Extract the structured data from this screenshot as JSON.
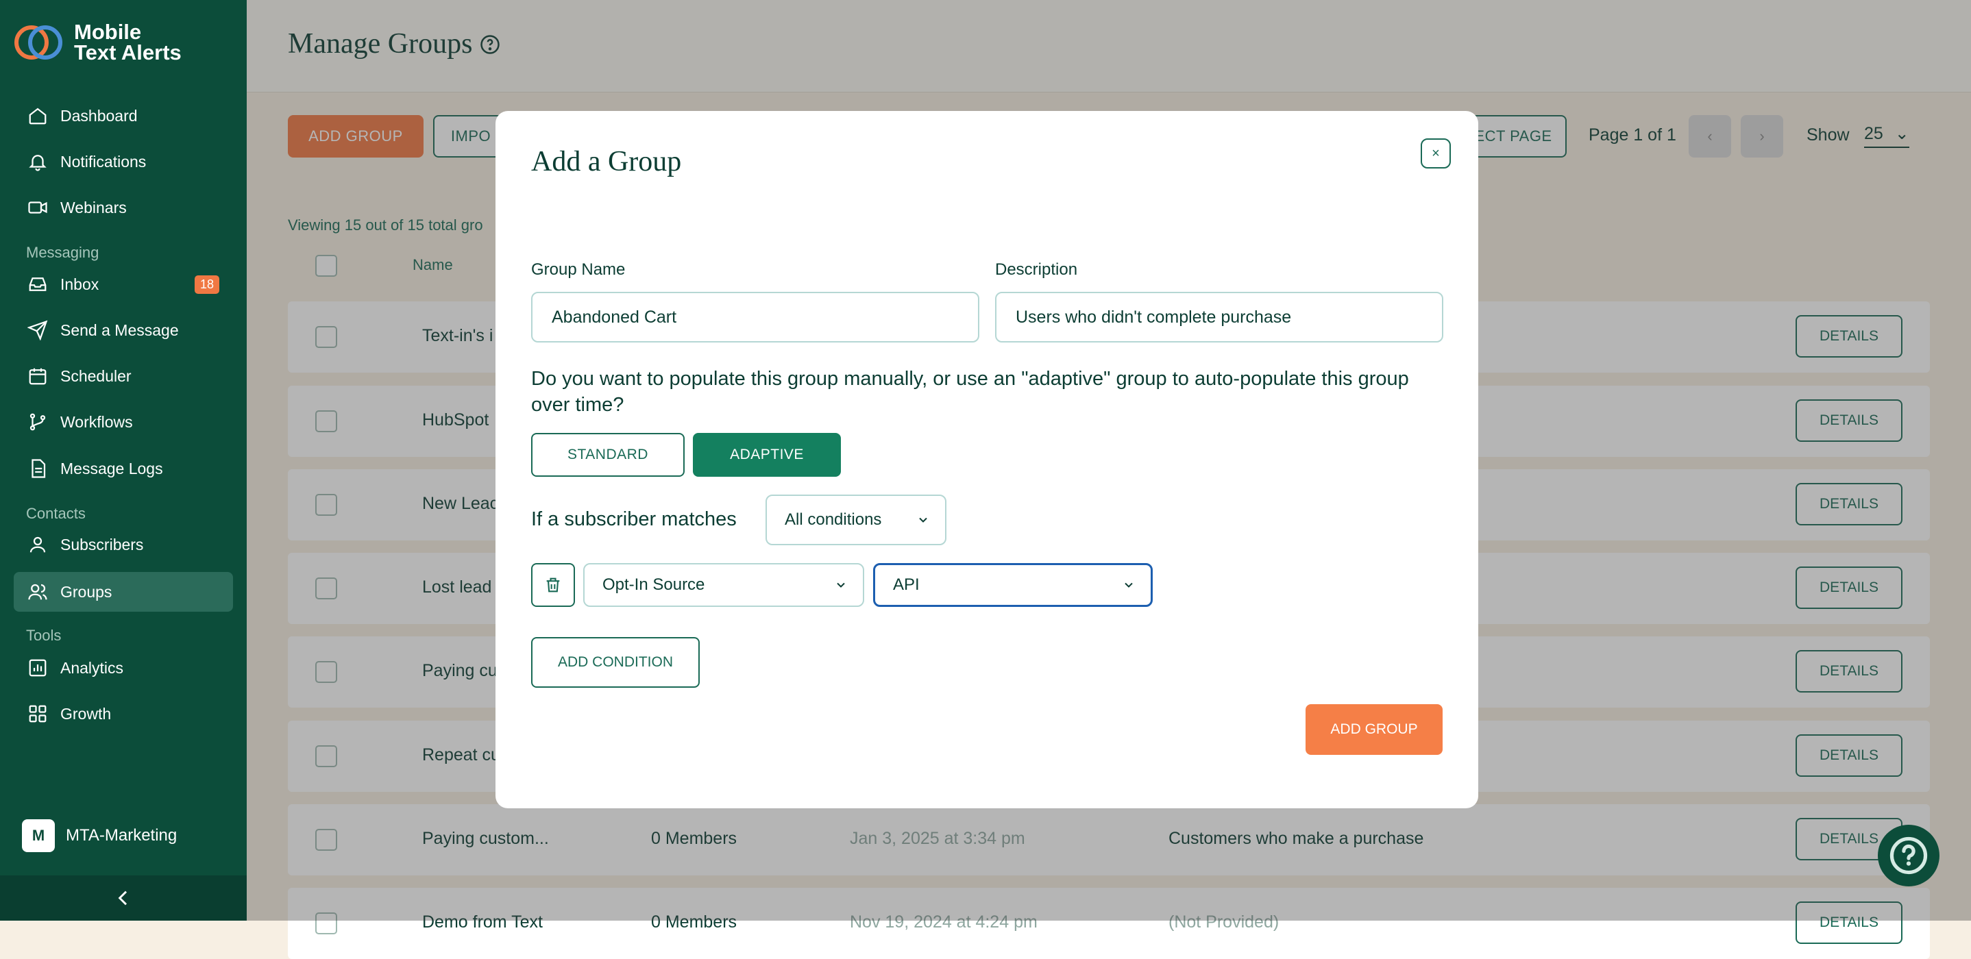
{
  "brand": {
    "line1": "Mobile",
    "line2": "Text Alerts"
  },
  "sidebar": {
    "items": [
      {
        "label": "Dashboard",
        "icon": "home-icon"
      },
      {
        "label": "Notifications",
        "icon": "bell-icon"
      },
      {
        "label": "Webinars",
        "icon": "video-icon"
      },
      {
        "label": "Inbox",
        "icon": "inbox-icon",
        "badge": "18"
      },
      {
        "label": "Send a Message",
        "icon": "send-icon"
      },
      {
        "label": "Scheduler",
        "icon": "calendar-icon"
      },
      {
        "label": "Workflows",
        "icon": "workflow-icon"
      },
      {
        "label": "Message Logs",
        "icon": "document-icon"
      },
      {
        "label": "Subscribers",
        "icon": "user-icon"
      },
      {
        "label": "Groups",
        "icon": "users-icon",
        "active": true
      },
      {
        "label": "Analytics",
        "icon": "chart-icon"
      },
      {
        "label": "Growth",
        "icon": "grid-icon"
      }
    ],
    "sections": {
      "messaging": "Messaging",
      "contacts": "Contacts",
      "tools": "Tools"
    },
    "account": {
      "initial": "M",
      "name": "MTA-Marketing"
    }
  },
  "header": {
    "title": "Manage Groups"
  },
  "toolbar": {
    "add_group": "ADD GROUP",
    "import": "IMPO",
    "select_page": "ECT PAGE",
    "page_info": "Page 1 of 1",
    "show_label": "Show",
    "show_value": "25"
  },
  "table": {
    "viewing": "Viewing 15 out of 15 total gro",
    "col_name": "Name",
    "details_label": "DETAILS",
    "rows": [
      {
        "name": "Text-in's i",
        "members": "",
        "date": "",
        "description": ""
      },
      {
        "name": "HubSpot",
        "members": "",
        "date": "",
        "description": ""
      },
      {
        "name": "New Leac",
        "members": "",
        "date": "",
        "description": ""
      },
      {
        "name": "Lost lead",
        "members": "",
        "date": "",
        "description": ""
      },
      {
        "name": "Paying cu",
        "members": "",
        "date": "",
        "description": ""
      },
      {
        "name": "Repeat cu",
        "members": "",
        "date": "",
        "description": ""
      },
      {
        "name": "Paying custom...",
        "members": "0 Members",
        "date": "Jan 3, 2025 at 3:34 pm",
        "description": "Customers who make a purchase"
      },
      {
        "name": "Demo from Text",
        "members": "0 Members",
        "date": "Nov 19, 2024 at 4:24 pm",
        "description": "(Not Provided)"
      }
    ]
  },
  "modal": {
    "title": "Add a Group",
    "close": "×",
    "group_name_label": "Group Name",
    "group_name_value": "Abandoned Cart",
    "description_label": "Description",
    "description_value": "Users who didn't complete purchase",
    "question": "Do you want to populate this group manually, or use an \"adaptive\" group to auto-populate this group over time?",
    "standard": "STANDARD",
    "adaptive": "ADAPTIVE",
    "match_label": "If a subscriber matches",
    "match_value": "All conditions",
    "condition_field": "Opt-In Source",
    "condition_value": "API",
    "add_condition": "ADD CONDITION",
    "submit": "ADD GROUP"
  }
}
